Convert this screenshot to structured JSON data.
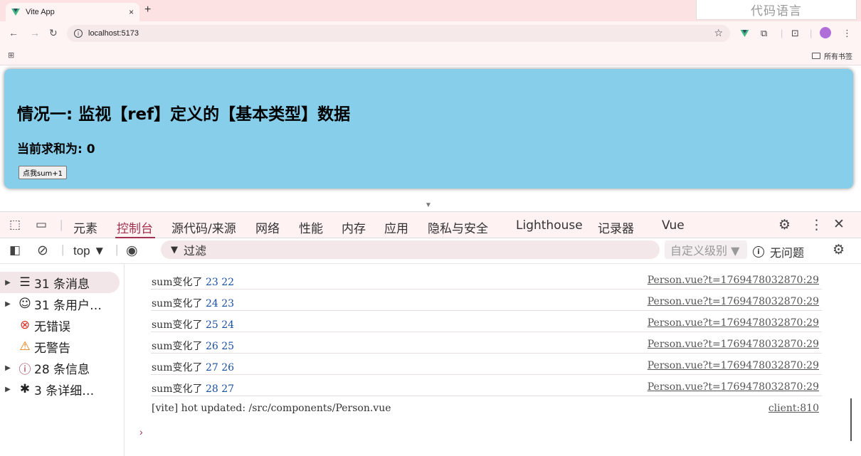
{
  "browser": {
    "tab_title": "Vite App",
    "tab_close": "×",
    "new_tab": "+",
    "url": "localhost:5173",
    "ime_text": "代码语言",
    "bookmarks_label": "所有书签"
  },
  "page": {
    "heading": "情况一: 监视【ref】定义的【基本类型】数据",
    "sum_label": "当前求和为: 0",
    "button_label": "点我sum+1"
  },
  "devtools": {
    "tabs": [
      "元素",
      "控制台",
      "源代码/来源",
      "网络",
      "性能",
      "内存",
      "应用",
      "隐私与安全",
      "Lighthouse",
      "记录器",
      "Vue"
    ],
    "active_tab": "控制台",
    "context": "top ▼",
    "filter_placeholder": "过滤",
    "level": "自定义级别 ▼",
    "issues": "无问题",
    "sidebar": [
      {
        "label": "31 条消息",
        "icon": "list-icon"
      },
      {
        "label": "31 条用户…",
        "icon": "user-icon"
      },
      {
        "label": "无错误",
        "icon": "error-icon"
      },
      {
        "label": "无警告",
        "icon": "warning-icon"
      },
      {
        "label": "28 条信息",
        "icon": "info-icon"
      },
      {
        "label": "3 条详细…",
        "icon": "bug-icon"
      }
    ],
    "logs": [
      {
        "text": "sum变化了",
        "a": "23",
        "b": "22",
        "source": "Person.vue?t=1769478032870:29"
      },
      {
        "text": "sum变化了",
        "a": "24",
        "b": "23",
        "source": "Person.vue?t=1769478032870:29"
      },
      {
        "text": "sum变化了",
        "a": "25",
        "b": "24",
        "source": "Person.vue?t=1769478032870:29"
      },
      {
        "text": "sum变化了",
        "a": "26",
        "b": "25",
        "source": "Person.vue?t=1769478032870:29"
      },
      {
        "text": "sum变化了",
        "a": "27",
        "b": "26",
        "source": "Person.vue?t=1769478032870:29"
      },
      {
        "text": "sum变化了",
        "a": "28",
        "b": "27",
        "source": "Person.vue?t=1769478032870:29"
      },
      {
        "text": "[vite] hot updated: /src/components/Person.vue",
        "a": "",
        "b": "",
        "source": "client:810"
      }
    ],
    "prompt": "›"
  },
  "colors": {
    "card_bg": "#87ceeb",
    "accent": "#a0334f",
    "number": "#1a4fa0"
  }
}
